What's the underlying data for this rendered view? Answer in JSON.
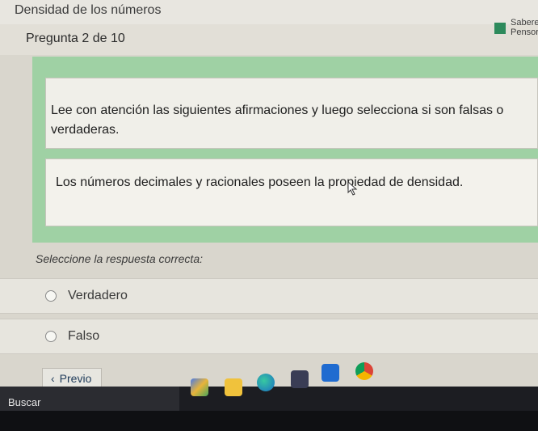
{
  "app": {
    "title": "Densidad de los números"
  },
  "header": {
    "question_counter": "Pregunta 2 de 10",
    "badge_line1": "Sabere",
    "badge_line2": "Pensor"
  },
  "question": {
    "instruction": "Lee con atención las siguientes afirmaciones y luego selecciona si son falsas o verdaderas.",
    "statement": "Los números decimales y racionales poseen la propiedad de densidad."
  },
  "answer": {
    "prompt": "Seleccione la respuesta correcta:",
    "options": [
      {
        "label": "Verdadero"
      },
      {
        "label": "Falso"
      }
    ]
  },
  "navigation": {
    "prev_label": "Previo"
  },
  "taskbar": {
    "search_label": "Buscar",
    "apps": [
      "copilot-icon",
      "file-explorer-icon",
      "edge-browser-icon",
      "store-icon",
      "outlook-icon",
      "chrome-icon"
    ]
  },
  "colors": {
    "panel_green": "#9fd1a4",
    "badge_green": "#2d8a5c",
    "taskbar": "#1c1d22"
  }
}
